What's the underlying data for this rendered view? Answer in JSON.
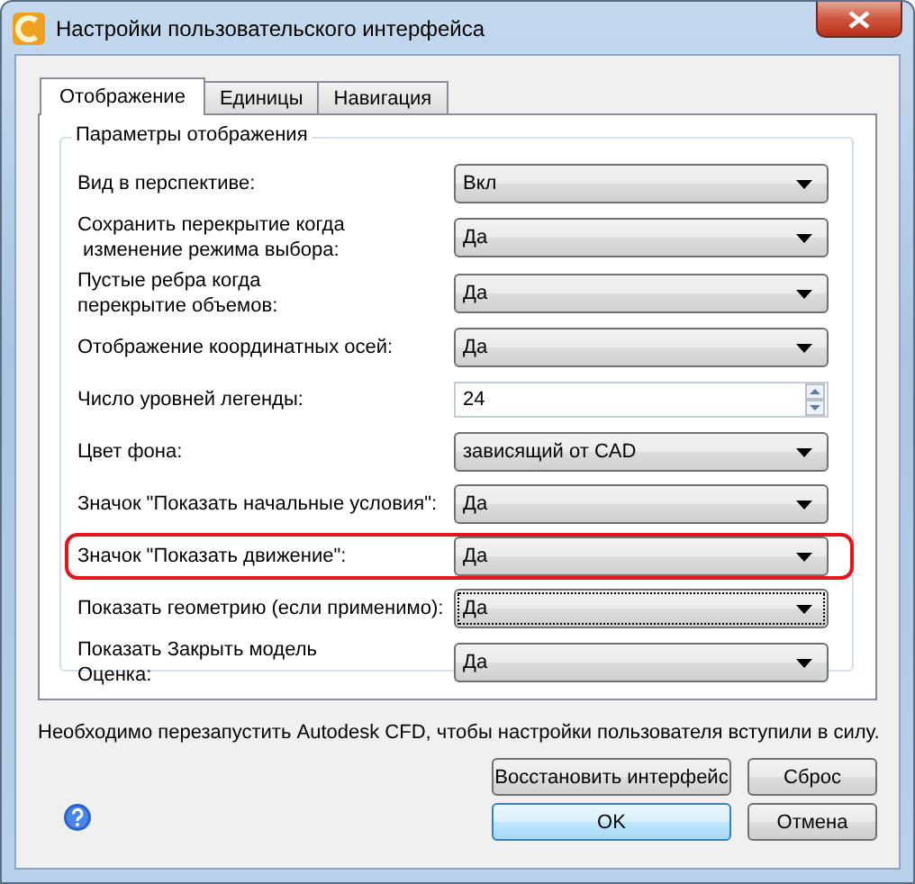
{
  "window": {
    "title": "Настройки пользовательского интерфейса"
  },
  "tabs": [
    {
      "label": "Отображение",
      "selected": true
    },
    {
      "label": "Единицы",
      "selected": false
    },
    {
      "label": "Навигация",
      "selected": false
    }
  ],
  "group": {
    "title": "Параметры отображения"
  },
  "rows": [
    {
      "kind": "combo",
      "label": "Вид в перспективе:",
      "value": "Вкл",
      "highlighted": false,
      "focused": false
    },
    {
      "kind": "combo",
      "label": "Сохранить перекрытие когда\n изменение режима выбора:",
      "value": "Да",
      "highlighted": false,
      "focused": false
    },
    {
      "kind": "combo",
      "label": "Пустые ребра когда\nперекрытие объемов:",
      "value": "Да",
      "highlighted": false,
      "focused": false
    },
    {
      "kind": "combo",
      "label": "Отображение координатных осей:",
      "value": "Да",
      "highlighted": false,
      "focused": false
    },
    {
      "kind": "spinner",
      "label": "Число уровней легенды:",
      "value": "24",
      "highlighted": false,
      "focused": false
    },
    {
      "kind": "combo",
      "label": "Цвет фона:",
      "value": "зависящий от CAD",
      "highlighted": false,
      "focused": false
    },
    {
      "kind": "combo",
      "label": "Значок \"Показать начальные условия\":",
      "value": "Да",
      "highlighted": false,
      "focused": false
    },
    {
      "kind": "combo",
      "label": "Значок \"Показать движение\":",
      "value": "Да",
      "highlighted": true,
      "focused": false
    },
    {
      "kind": "combo",
      "label": "Показать геометрию (если применимо):",
      "value": "Да",
      "highlighted": false,
      "focused": true
    },
    {
      "kind": "combo",
      "label": "Показать Закрыть модель\nОценка:",
      "value": "Да",
      "highlighted": false,
      "focused": false
    }
  ],
  "message": "Необходимо перезапустить Autodesk CFD, чтобы настройки пользователя вступили в силу.",
  "buttons": [
    {
      "label": "Восстановить интерфейс",
      "default": false
    },
    {
      "label": "Сброс",
      "default": false
    },
    {
      "label": "OK",
      "default": true
    },
    {
      "label": "Отмена",
      "default": false
    }
  ]
}
